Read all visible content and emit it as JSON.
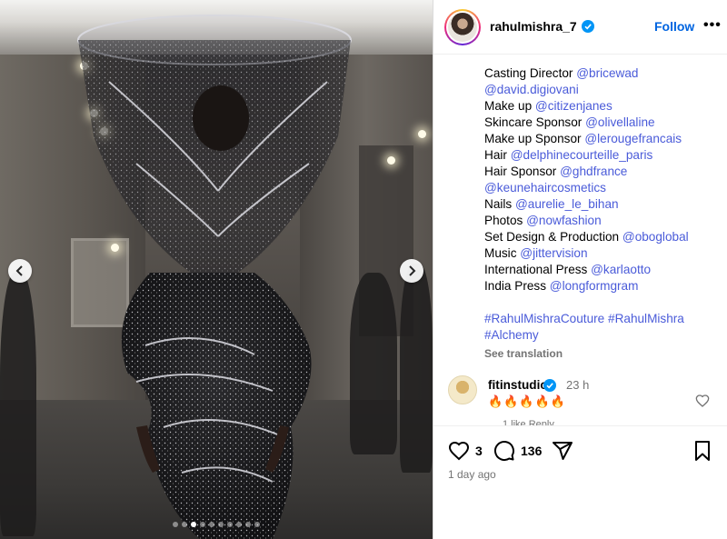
{
  "post": {
    "username": "rahulmishra_7",
    "follow_label": "Follow",
    "more_label": "•••",
    "media": {
      "slide_count": 10,
      "active_slide": 3
    }
  },
  "caption": {
    "lines": [
      [
        {
          "t": "Casting Director "
        },
        {
          "t": "@bricewad",
          "m": true
        }
      ],
      [
        {
          "t": "@david.digiovani",
          "m": true
        }
      ],
      [
        {
          "t": "Make up "
        },
        {
          "t": "@citizenjanes",
          "m": true
        }
      ],
      [
        {
          "t": "Skincare Sponsor "
        },
        {
          "t": "@olivellaline",
          "m": true
        }
      ],
      [
        {
          "t": "Make up Sponsor "
        },
        {
          "t": "@lerougefrancais",
          "m": true
        }
      ],
      [
        {
          "t": "Hair "
        },
        {
          "t": "@delphinecourteille_paris",
          "m": true
        }
      ],
      [
        {
          "t": "Hair Sponsor "
        },
        {
          "t": "@ghdfrance",
          "m": true
        }
      ],
      [
        {
          "t": "@keunehaircosmetics",
          "m": true
        }
      ],
      [
        {
          "t": "Nails "
        },
        {
          "t": "@aurelie_le_bihan",
          "m": true
        }
      ],
      [
        {
          "t": "Photos "
        },
        {
          "t": "@nowfashion",
          "m": true
        }
      ],
      [
        {
          "t": "Set Design & Production "
        },
        {
          "t": "@oboglobal",
          "m": true
        }
      ],
      [
        {
          "t": "Music "
        },
        {
          "t": "@jittervision",
          "m": true
        }
      ],
      [
        {
          "t": "International Press "
        },
        {
          "t": "@karlaotto",
          "m": true
        }
      ],
      [
        {
          "t": "India Press "
        },
        {
          "t": "@longformgram",
          "m": true
        }
      ],
      [],
      [
        {
          "t": "#RahulMishraCouture #RahulMishra",
          "m": true
        }
      ],
      [
        {
          "t": "#Alchemy",
          "m": true
        }
      ]
    ],
    "see_translation": "See translation"
  },
  "comment": {
    "username": "fitinstudio",
    "time": "23 h",
    "text": "🔥🔥🔥🔥🔥",
    "meta": "1 like    Reply"
  },
  "actions": {
    "likes": "3",
    "comments": "136",
    "time_ago": "1 day ago"
  },
  "colors": {
    "accent": "#0064e0",
    "mention": "#4a5bd9",
    "verified": "#0095f6",
    "muted": "#737373"
  }
}
